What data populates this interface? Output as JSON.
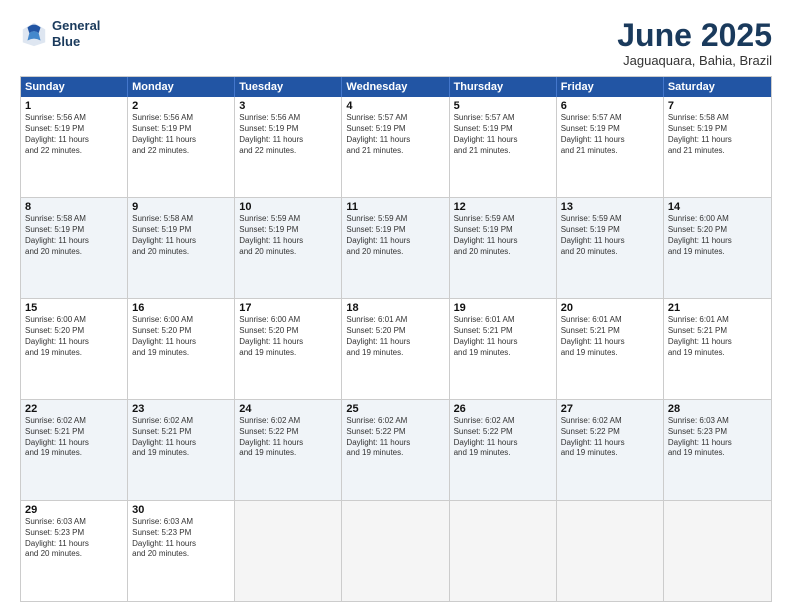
{
  "header": {
    "logo_line1": "General",
    "logo_line2": "Blue",
    "month": "June 2025",
    "location": "Jaguaquara, Bahia, Brazil"
  },
  "days_of_week": [
    "Sunday",
    "Monday",
    "Tuesday",
    "Wednesday",
    "Thursday",
    "Friday",
    "Saturday"
  ],
  "rows": [
    {
      "alt": false,
      "cells": [
        {
          "day": "1",
          "lines": [
            "Sunrise: 5:56 AM",
            "Sunset: 5:19 PM",
            "Daylight: 11 hours",
            "and 22 minutes."
          ]
        },
        {
          "day": "2",
          "lines": [
            "Sunrise: 5:56 AM",
            "Sunset: 5:19 PM",
            "Daylight: 11 hours",
            "and 22 minutes."
          ]
        },
        {
          "day": "3",
          "lines": [
            "Sunrise: 5:56 AM",
            "Sunset: 5:19 PM",
            "Daylight: 11 hours",
            "and 22 minutes."
          ]
        },
        {
          "day": "4",
          "lines": [
            "Sunrise: 5:57 AM",
            "Sunset: 5:19 PM",
            "Daylight: 11 hours",
            "and 21 minutes."
          ]
        },
        {
          "day": "5",
          "lines": [
            "Sunrise: 5:57 AM",
            "Sunset: 5:19 PM",
            "Daylight: 11 hours",
            "and 21 minutes."
          ]
        },
        {
          "day": "6",
          "lines": [
            "Sunrise: 5:57 AM",
            "Sunset: 5:19 PM",
            "Daylight: 11 hours",
            "and 21 minutes."
          ]
        },
        {
          "day": "7",
          "lines": [
            "Sunrise: 5:58 AM",
            "Sunset: 5:19 PM",
            "Daylight: 11 hours",
            "and 21 minutes."
          ]
        }
      ]
    },
    {
      "alt": true,
      "cells": [
        {
          "day": "8",
          "lines": [
            "Sunrise: 5:58 AM",
            "Sunset: 5:19 PM",
            "Daylight: 11 hours",
            "and 20 minutes."
          ]
        },
        {
          "day": "9",
          "lines": [
            "Sunrise: 5:58 AM",
            "Sunset: 5:19 PM",
            "Daylight: 11 hours",
            "and 20 minutes."
          ]
        },
        {
          "day": "10",
          "lines": [
            "Sunrise: 5:59 AM",
            "Sunset: 5:19 PM",
            "Daylight: 11 hours",
            "and 20 minutes."
          ]
        },
        {
          "day": "11",
          "lines": [
            "Sunrise: 5:59 AM",
            "Sunset: 5:19 PM",
            "Daylight: 11 hours",
            "and 20 minutes."
          ]
        },
        {
          "day": "12",
          "lines": [
            "Sunrise: 5:59 AM",
            "Sunset: 5:19 PM",
            "Daylight: 11 hours",
            "and 20 minutes."
          ]
        },
        {
          "day": "13",
          "lines": [
            "Sunrise: 5:59 AM",
            "Sunset: 5:19 PM",
            "Daylight: 11 hours",
            "and 20 minutes."
          ]
        },
        {
          "day": "14",
          "lines": [
            "Sunrise: 6:00 AM",
            "Sunset: 5:20 PM",
            "Daylight: 11 hours",
            "and 19 minutes."
          ]
        }
      ]
    },
    {
      "alt": false,
      "cells": [
        {
          "day": "15",
          "lines": [
            "Sunrise: 6:00 AM",
            "Sunset: 5:20 PM",
            "Daylight: 11 hours",
            "and 19 minutes."
          ]
        },
        {
          "day": "16",
          "lines": [
            "Sunrise: 6:00 AM",
            "Sunset: 5:20 PM",
            "Daylight: 11 hours",
            "and 19 minutes."
          ]
        },
        {
          "day": "17",
          "lines": [
            "Sunrise: 6:00 AM",
            "Sunset: 5:20 PM",
            "Daylight: 11 hours",
            "and 19 minutes."
          ]
        },
        {
          "day": "18",
          "lines": [
            "Sunrise: 6:01 AM",
            "Sunset: 5:20 PM",
            "Daylight: 11 hours",
            "and 19 minutes."
          ]
        },
        {
          "day": "19",
          "lines": [
            "Sunrise: 6:01 AM",
            "Sunset: 5:21 PM",
            "Daylight: 11 hours",
            "and 19 minutes."
          ]
        },
        {
          "day": "20",
          "lines": [
            "Sunrise: 6:01 AM",
            "Sunset: 5:21 PM",
            "Daylight: 11 hours",
            "and 19 minutes."
          ]
        },
        {
          "day": "21",
          "lines": [
            "Sunrise: 6:01 AM",
            "Sunset: 5:21 PM",
            "Daylight: 11 hours",
            "and 19 minutes."
          ]
        }
      ]
    },
    {
      "alt": true,
      "cells": [
        {
          "day": "22",
          "lines": [
            "Sunrise: 6:02 AM",
            "Sunset: 5:21 PM",
            "Daylight: 11 hours",
            "and 19 minutes."
          ]
        },
        {
          "day": "23",
          "lines": [
            "Sunrise: 6:02 AM",
            "Sunset: 5:21 PM",
            "Daylight: 11 hours",
            "and 19 minutes."
          ]
        },
        {
          "day": "24",
          "lines": [
            "Sunrise: 6:02 AM",
            "Sunset: 5:22 PM",
            "Daylight: 11 hours",
            "and 19 minutes."
          ]
        },
        {
          "day": "25",
          "lines": [
            "Sunrise: 6:02 AM",
            "Sunset: 5:22 PM",
            "Daylight: 11 hours",
            "and 19 minutes."
          ]
        },
        {
          "day": "26",
          "lines": [
            "Sunrise: 6:02 AM",
            "Sunset: 5:22 PM",
            "Daylight: 11 hours",
            "and 19 minutes."
          ]
        },
        {
          "day": "27",
          "lines": [
            "Sunrise: 6:02 AM",
            "Sunset: 5:22 PM",
            "Daylight: 11 hours",
            "and 19 minutes."
          ]
        },
        {
          "day": "28",
          "lines": [
            "Sunrise: 6:03 AM",
            "Sunset: 5:23 PM",
            "Daylight: 11 hours",
            "and 19 minutes."
          ]
        }
      ]
    },
    {
      "alt": false,
      "cells": [
        {
          "day": "29",
          "lines": [
            "Sunrise: 6:03 AM",
            "Sunset: 5:23 PM",
            "Daylight: 11 hours",
            "and 20 minutes."
          ]
        },
        {
          "day": "30",
          "lines": [
            "Sunrise: 6:03 AM",
            "Sunset: 5:23 PM",
            "Daylight: 11 hours",
            "and 20 minutes."
          ]
        },
        {
          "day": "",
          "lines": []
        },
        {
          "day": "",
          "lines": []
        },
        {
          "day": "",
          "lines": []
        },
        {
          "day": "",
          "lines": []
        },
        {
          "day": "",
          "lines": []
        }
      ]
    }
  ]
}
